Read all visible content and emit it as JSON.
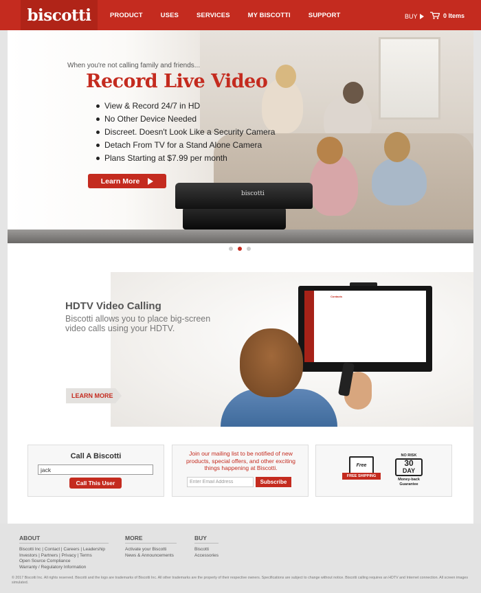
{
  "header": {
    "logo": "biscotti",
    "nav": [
      "PRODUCT",
      "USES",
      "SERVICES",
      "MY BISCOTTI",
      "SUPPORT"
    ],
    "buy_label": "BUY",
    "cart_label": "0 Items",
    "brand_color": "#c42b1f"
  },
  "hero": {
    "subtitle": "When you're not calling family and friends...",
    "title": "Record Live Video",
    "bullets": [
      "View & Record 24/7 in HD",
      "No Other Device Needed",
      "Discreet. Doesn't Look Like a Security Camera",
      "Detach From TV for a Stand Alone Camera",
      "Plans Starting at $7.99 per month"
    ],
    "cta": "Learn More",
    "camera_label": "biscotti",
    "slides": 3,
    "active_slide": 2
  },
  "hdtv": {
    "title": "HDTV Video Calling",
    "description": "Biscotti allows you to place big-screen video calls using your HDTV.",
    "cta": "LEARN MORE",
    "screen_contacts": "Contacts"
  },
  "call_box": {
    "title": "Call A Biscotti",
    "input_value": "jack",
    "button": "Call This User"
  },
  "mailing_box": {
    "message": "Join our mailing list to be notified of new products, special offers, and other exciting things happening at Biscotti.",
    "placeholder": "Enter Email Address",
    "button": "Subscribe"
  },
  "badges": {
    "free": "Free",
    "shipping": "FREE SHIPPING",
    "no_risk": "NO RISK",
    "days_num": "30",
    "days_label": "DAY",
    "money_back": "Money-back Guarantee"
  },
  "footer": {
    "about": {
      "title": "ABOUT",
      "lines": [
        "Biscotti Inc | Contact | Careers | Leadership",
        "Investors | Partners | Privacy | Terms",
        "Open Source Compliance",
        "Warranty / Regulatory Information"
      ]
    },
    "more": {
      "title": "MORE",
      "lines": [
        "Activate your Biscotti",
        "News & Announcements"
      ]
    },
    "buy": {
      "title": "BUY",
      "lines": [
        "Biscotti",
        "Accessories"
      ]
    },
    "copyright": "© 2017 Biscotti Inc. All rights reserved. Biscotti and the logo are trademarks of Biscotti Inc. All other trademarks are the property of their respective owners. Specifications are subject to change without notice. Biscotti calling requires an HDTV and Internet connection. All screen images simulated."
  }
}
